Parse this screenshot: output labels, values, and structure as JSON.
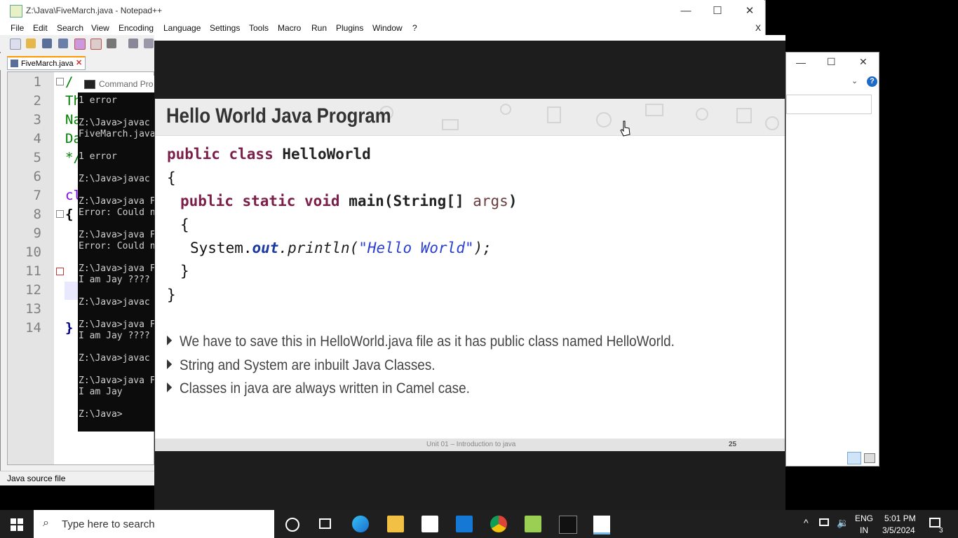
{
  "notepad": {
    "title": "Z:\\Java\\FiveMarch.java - Notepad++",
    "menu": [
      "File",
      "Edit",
      "Search",
      "View",
      "Encoding",
      "Language",
      "Settings",
      "Tools",
      "Macro",
      "Run",
      "Plugins",
      "Window",
      "?"
    ],
    "close_x": "X",
    "tab_label": "FiveMarch.java",
    "line_numbers": [
      "1",
      "2",
      "3",
      "4",
      "5",
      "6",
      "7",
      "8",
      "9",
      "10",
      "11",
      "12",
      "13",
      "14"
    ],
    "code_fragments": [
      "/",
      "Th",
      "Na",
      "Da",
      "*/",
      "",
      "cl",
      "{",
      "",
      "",
      "",
      "",
      "",
      "}"
    ],
    "status_text": "Java source file"
  },
  "cmd": {
    "title": "Command Pro",
    "lines": [
      "1 error",
      "",
      "Z:\\Java>javac",
      "FiveMarch.java",
      "",
      "1 error",
      "",
      "Z:\\Java>javac",
      "",
      "Z:\\Java>java F",
      "Error: Could n",
      "",
      "Z:\\Java>java F",
      "Error: Could n",
      "",
      "Z:\\Java>java F",
      "I am Jay ????",
      "",
      "Z:\\Java>javac",
      "",
      "Z:\\Java>java F",
      "I am Jay ????",
      "",
      "Z:\\Java>javac",
      "",
      "Z:\\Java>java F",
      "I am Jay",
      "",
      "Z:\\Java>"
    ]
  },
  "slide": {
    "title": "Hello World Java Program",
    "code": {
      "l1_kw": "public class",
      "l1_name": "HelloWorld",
      "l2": "{",
      "l3_kw": "public static void",
      "l3_main": "main",
      "l3_args1": "(String[] ",
      "l3_args2": "args",
      "l3_end": ")",
      "l4": "{",
      "l5_sys": "System.",
      "l5_out": "out",
      "l5_print": ".println(",
      "l5_str": "\"Hello World\"",
      "l5_end": ");",
      "l6": "}",
      "l7": "}"
    },
    "bullets": [
      "We have to save this in HelloWorld.java file as it has public class named HelloWorld.",
      "String and System are inbuilt Java Classes.",
      "Classes in java are always written in Camel case."
    ],
    "footer_text": "Unit 01 – Introduction to java",
    "page_number": "25"
  },
  "taskbar": {
    "search_placeholder": "Type here to search",
    "lang_line1": "ENG",
    "lang_line2": "IN",
    "time": "5:01 PM",
    "date": "3/5/2024",
    "notification_count": "3"
  },
  "colors": {
    "keyword": "#7b1f4a",
    "string": "#2a3fd0",
    "taskbar": "#1f1f1f",
    "gutter": "#e4e4e4"
  }
}
